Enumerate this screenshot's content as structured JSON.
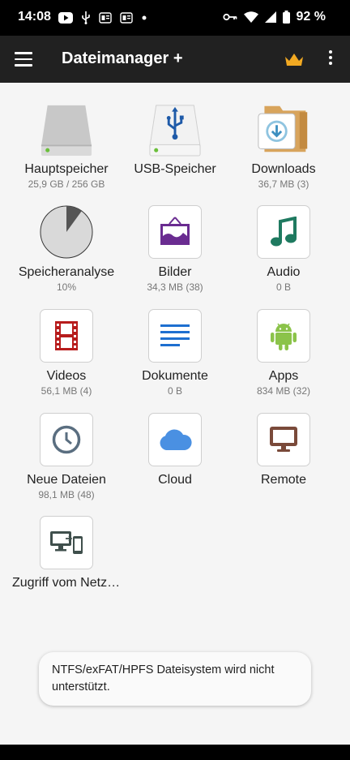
{
  "status_bar": {
    "time": "14:08",
    "battery": "92 %"
  },
  "app_bar": {
    "title": "Dateimanager +"
  },
  "tiles": [
    {
      "label": "Hauptspeicher",
      "sub": "25,9 GB / 256 GB"
    },
    {
      "label": "USB-Speicher",
      "sub": ""
    },
    {
      "label": "Downloads",
      "sub": "36,7 MB (3)"
    },
    {
      "label": "Speicheranalyse",
      "sub": "10%"
    },
    {
      "label": "Bilder",
      "sub": "34,3 MB (38)"
    },
    {
      "label": "Audio",
      "sub": "0 B"
    },
    {
      "label": "Videos",
      "sub": "56,1 MB (4)"
    },
    {
      "label": "Dokumente",
      "sub": "0 B"
    },
    {
      "label": "Apps",
      "sub": "834 MB (32)"
    },
    {
      "label": "Neue Dateien",
      "sub": "98,1 MB (48)"
    },
    {
      "label": "Cloud",
      "sub": ""
    },
    {
      "label": "Remote",
      "sub": ""
    },
    {
      "label": "Zugriff vom Netzwerk",
      "sub": ""
    }
  ],
  "toast": {
    "text": "NTFS/exFAT/HPFS Dateisystem wird nicht unterstützt."
  },
  "colors": {
    "app_bar": "#212121",
    "crown": "#f2a922",
    "images": "#6a2c91",
    "audio": "#1f7a60",
    "videos": "#b71c1c",
    "documents": "#1e6fd0",
    "apps": "#8bc34a",
    "cloud": "#4a90e2",
    "remote": "#7a4a3a"
  }
}
